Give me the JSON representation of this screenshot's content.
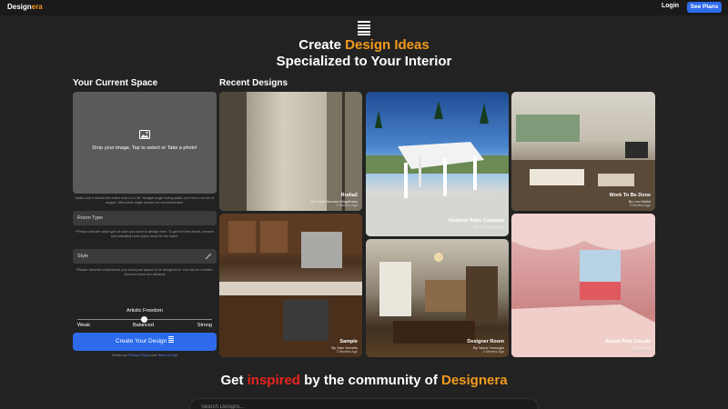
{
  "nav": {
    "logo_main": "Design",
    "logo_accent": "era",
    "login": "Login",
    "see_plans": "See Plans"
  },
  "hero": {
    "line1_plain": "Create ",
    "line1_highlight": "Design Ideas",
    "line2": "Specialized to Your Interior"
  },
  "left": {
    "heading": "Your Current Space",
    "upload_text": "Drop your image, Tap to select or Take a photo!",
    "upload_hint": "Make sure it shows the entire room in a 90° straight angle facing walls, not from a corner or angled. Ultra-wide angle lenses not recommended.",
    "room_type_label": "Room Type",
    "room_type_hint": "*Please indicate what type of room you want to design here. To get the best result, present and indicated room types must be the same.",
    "style_label": "Style",
    "style_hint": "*Please describe what theme you want your space to be designed in! You can be creative. General terms are advised.",
    "freedom_label": "Artistic Freedom",
    "freedom_options": [
      "Weak",
      "Balanced",
      "Strong"
    ],
    "freedom_value": 0.5,
    "create_button": "Create Your Design",
    "terms_prefix": "Check our ",
    "terms_privacy": "Privacy Policy",
    "terms_and": " and ",
    "terms_tos": "Terms of Use"
  },
  "recent": {
    "heading": "Recent Designs",
    "cards": [
      {
        "title": "Rudia2",
        "by": "By Rudd Tavares Magalhaes",
        "date": "2 Months Ago"
      },
      {
        "title": "Outdoor Patio Cabanas",
        "by": "By Zeren Markovic",
        "date": "2 Months Ago"
      },
      {
        "title": "Work To Be Done",
        "by": "By Leo Mallot",
        "date": "2 Months Ago"
      },
      {
        "title": "Sample",
        "by": "By Sam Sorrells",
        "date": "2 Months Ago"
      },
      {
        "title": "Designer Room",
        "by": "By Yavuz Yusuoglu",
        "date": "2 Months Ago"
      },
      {
        "title": "Above Pink Clouds",
        "by": "By thenery",
        "date": "2 Months Ago"
      }
    ]
  },
  "community": {
    "part1": "Get ",
    "highlight1": "inspired",
    "part2": " by the community of ",
    "highlight2": "Designera",
    "search_placeholder": "Search Designs..."
  },
  "colors": {
    "accent_orange": "#f29a1c",
    "accent_red": "#e8251d",
    "primary_blue": "#2d6bec",
    "background": "#222222"
  }
}
